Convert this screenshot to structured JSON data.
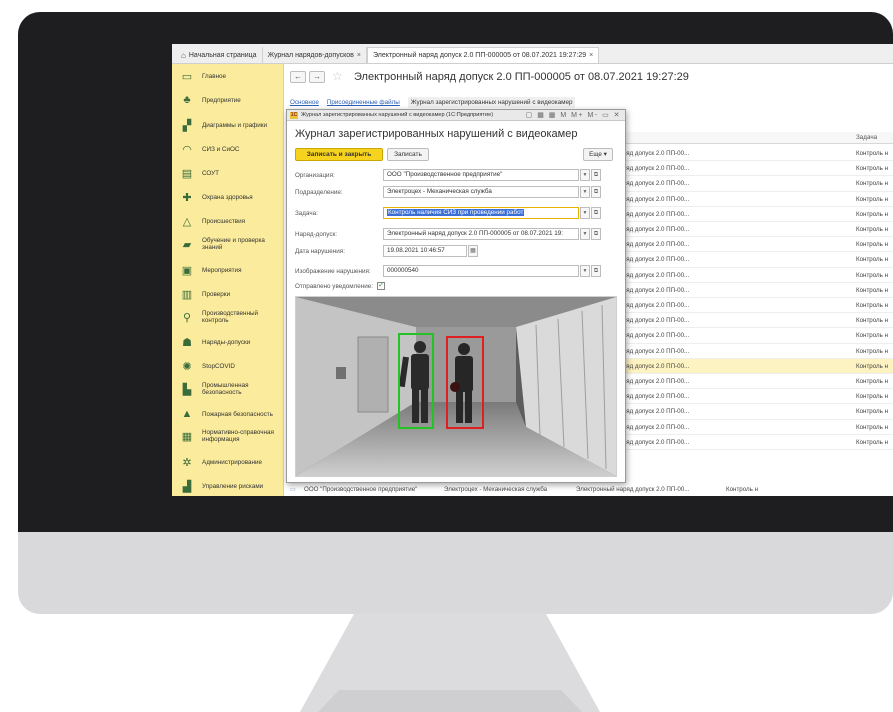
{
  "tabs": [
    {
      "label": "Начальная страница",
      "close": ""
    },
    {
      "label": "Журнал нарядов-допусков",
      "close": "×"
    },
    {
      "label": "Электронный наряд допуск 2.0 ПП-000005 от 08.07.2021 19:27:29",
      "close": "×"
    }
  ],
  "sidebar": {
    "items": [
      {
        "label": "Главное"
      },
      {
        "label": "Предприятие"
      },
      {
        "label": "Диаграммы и графики"
      },
      {
        "label": "СИЗ и СиОС"
      },
      {
        "label": "СОУТ"
      },
      {
        "label": "Охрана здоровья"
      },
      {
        "label": "Происшествия"
      },
      {
        "label": "Обучение и проверка знаний"
      },
      {
        "label": "Мероприятия"
      },
      {
        "label": "Проверки"
      },
      {
        "label": "Производственный контроль"
      },
      {
        "label": "Наряды-допуски"
      },
      {
        "label": "StopCOVID"
      },
      {
        "label": "Промышленная безопасность"
      },
      {
        "label": "Пожарная безопасность"
      },
      {
        "label": "Нормативно-справочная информация"
      },
      {
        "label": "Администрирование"
      },
      {
        "label": "Управление рисками"
      }
    ]
  },
  "main": {
    "back": "←",
    "forward": "→",
    "title": "Электронный наряд допуск 2.0 ПП-000005 от 08.07.2021 19:27:29",
    "subtabs": [
      "Основное",
      "Присоединенные файлы",
      "Журнал зарегистрированных нарушений с видеокамер"
    ]
  },
  "list": {
    "col_k": "к",
    "col_task": "Задача",
    "cell_doc": "наряд допуск 2.0 ПП-00...",
    "cell_task": "Контроль н",
    "rows": 20,
    "highlight_row": 14,
    "bottom": {
      "org": "ООО \"Производственное предприятие\"",
      "dept": "Электроцех - Механическая служба",
      "doc": "Электронный наряд допуск 2.0 ПП-00...",
      "task": "Контроль н"
    }
  },
  "dialog": {
    "window_title": "Журнал зарегистрированных нарушений с видеокамер  (1С:Предприятие)",
    "window_controls": "▢ ▦ ▦ M M+ M- ▭ ✕",
    "heading": "Журнал зарегистрированных нарушений с видеокамер",
    "save_close": "Записать и закрыть",
    "save": "Записать",
    "more": "Еще ▾",
    "fields": {
      "org_label": "Организация:",
      "org_value": "ООО \"Производственное предприятие\"",
      "dept_label": "Подразделение:",
      "dept_value": "Электроцех - Механическая служба",
      "task_label": "Задача:",
      "task_value": "Контроль наличия СИЗ при проведении работ",
      "permit_label": "Наряд-допуск:",
      "permit_value": "Электронный наряд допуск 2.0 ПП-000005 от 08.07.2021 19:",
      "date_label": "Дата нарушения:",
      "date_value": "19.08.2021 10:46:57",
      "image_label": "Изображение нарушения:",
      "image_value": "000000540",
      "notify_label": "Отправлено уведомление:",
      "notify_checked": "✓"
    }
  },
  "colors": {
    "sidebar": "#fbeb9c",
    "primary_button": "#f5d31e",
    "selection": "#3b6fd6",
    "bbox_green": "#22c322",
    "bbox_red": "#e02020"
  }
}
